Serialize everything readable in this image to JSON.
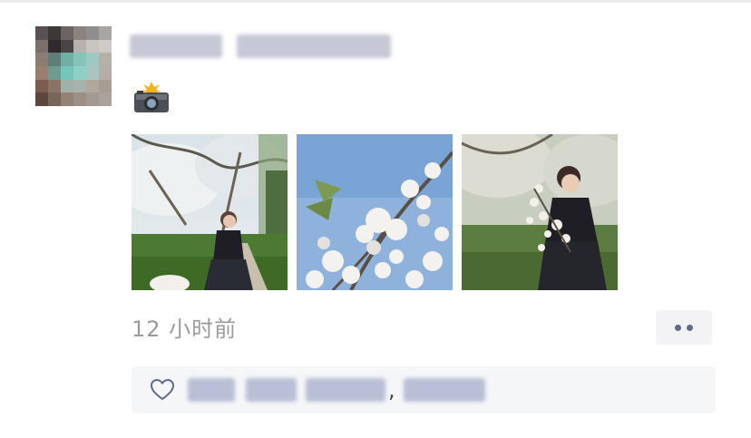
{
  "post": {
    "time": "12 小时前",
    "camera_icon": "camera-with-flash-icon",
    "more_icon": "more-dots-icon",
    "photo_count": 3
  },
  "likes": {
    "icon": "heart-outline-icon",
    "separator": ","
  },
  "colors": {
    "time_text": "#9a9a9a",
    "link_blue": "#5e6b8d",
    "likes_bg": "#f5f6f8",
    "more_button_bg": "#f3f3f5"
  }
}
